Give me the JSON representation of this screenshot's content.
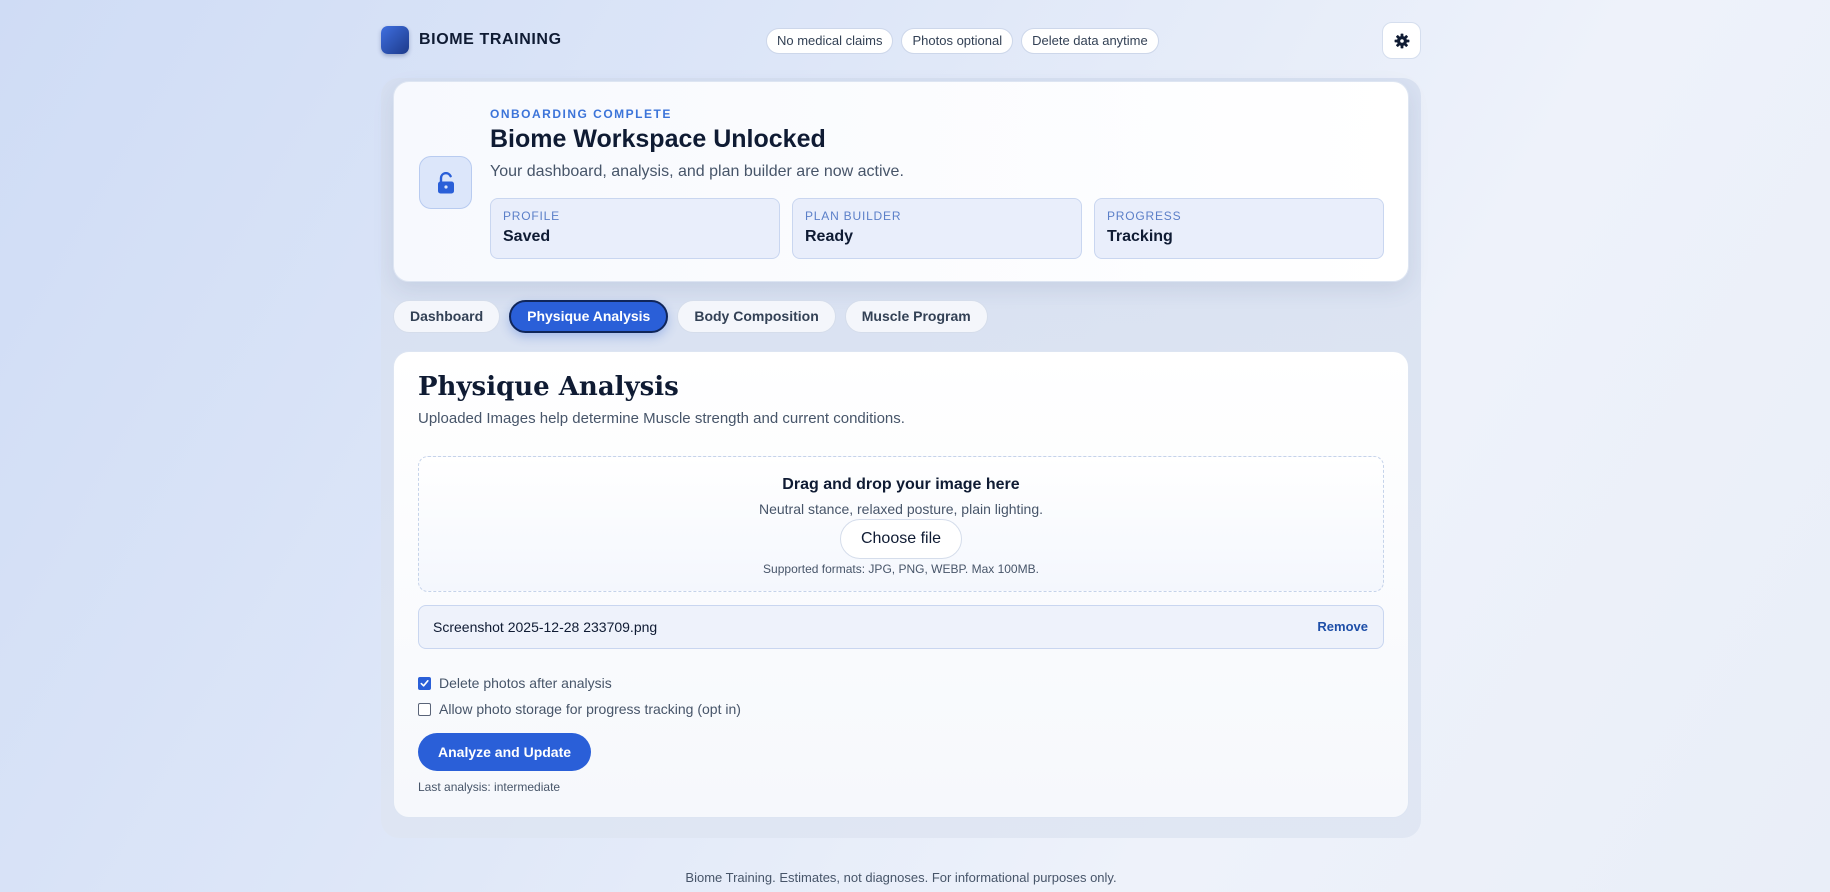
{
  "brand": {
    "name": "BIOME TRAINING",
    "logo_icon": "app-logo"
  },
  "header_pills": [
    "No medical claims",
    "Photos optional",
    "Delete data anytime"
  ],
  "settings_icon": "gear-icon",
  "hero": {
    "eyebrow": "ONBOARDING COMPLETE",
    "title": "Biome Workspace Unlocked",
    "subtitle": "Your dashboard, analysis, and plan builder are now active.",
    "icon": "unlock-icon",
    "stats": [
      {
        "label": "PROFILE",
        "value": "Saved"
      },
      {
        "label": "PLAN BUILDER",
        "value": "Ready"
      },
      {
        "label": "PROGRESS",
        "value": "Tracking"
      }
    ]
  },
  "tabs": [
    {
      "label": "Dashboard",
      "active": false
    },
    {
      "label": "Physique Analysis",
      "active": true
    },
    {
      "label": "Body Composition",
      "active": false
    },
    {
      "label": "Muscle Program",
      "active": false
    }
  ],
  "analysis": {
    "title": "Physique Analysis",
    "subtitle": "Uploaded Images help determine Muscle strength and current conditions.",
    "dropzone": {
      "title": "Drag and drop your image here",
      "hint": "Neutral stance, relaxed posture, plain lighting.",
      "choose_label": "Choose file",
      "formats": "Supported formats: JPG, PNG, WEBP. Max 100MB."
    },
    "file": {
      "name": "Screenshot 2025-12-28 233709.png",
      "remove_label": "Remove"
    },
    "options": [
      {
        "label": "Delete photos after analysis",
        "checked": true
      },
      {
        "label": "Allow photo storage for progress tracking (opt in)",
        "checked": false
      }
    ],
    "analyze_label": "Analyze and Update",
    "last_analysis": "Last analysis: intermediate"
  },
  "footer": "Biome Training. Estimates, not diagnoses. For informational purposes only.",
  "colors": {
    "accent": "#2a5fd8",
    "eyebrow": "#3c74d9",
    "text": "#0f1b33"
  }
}
